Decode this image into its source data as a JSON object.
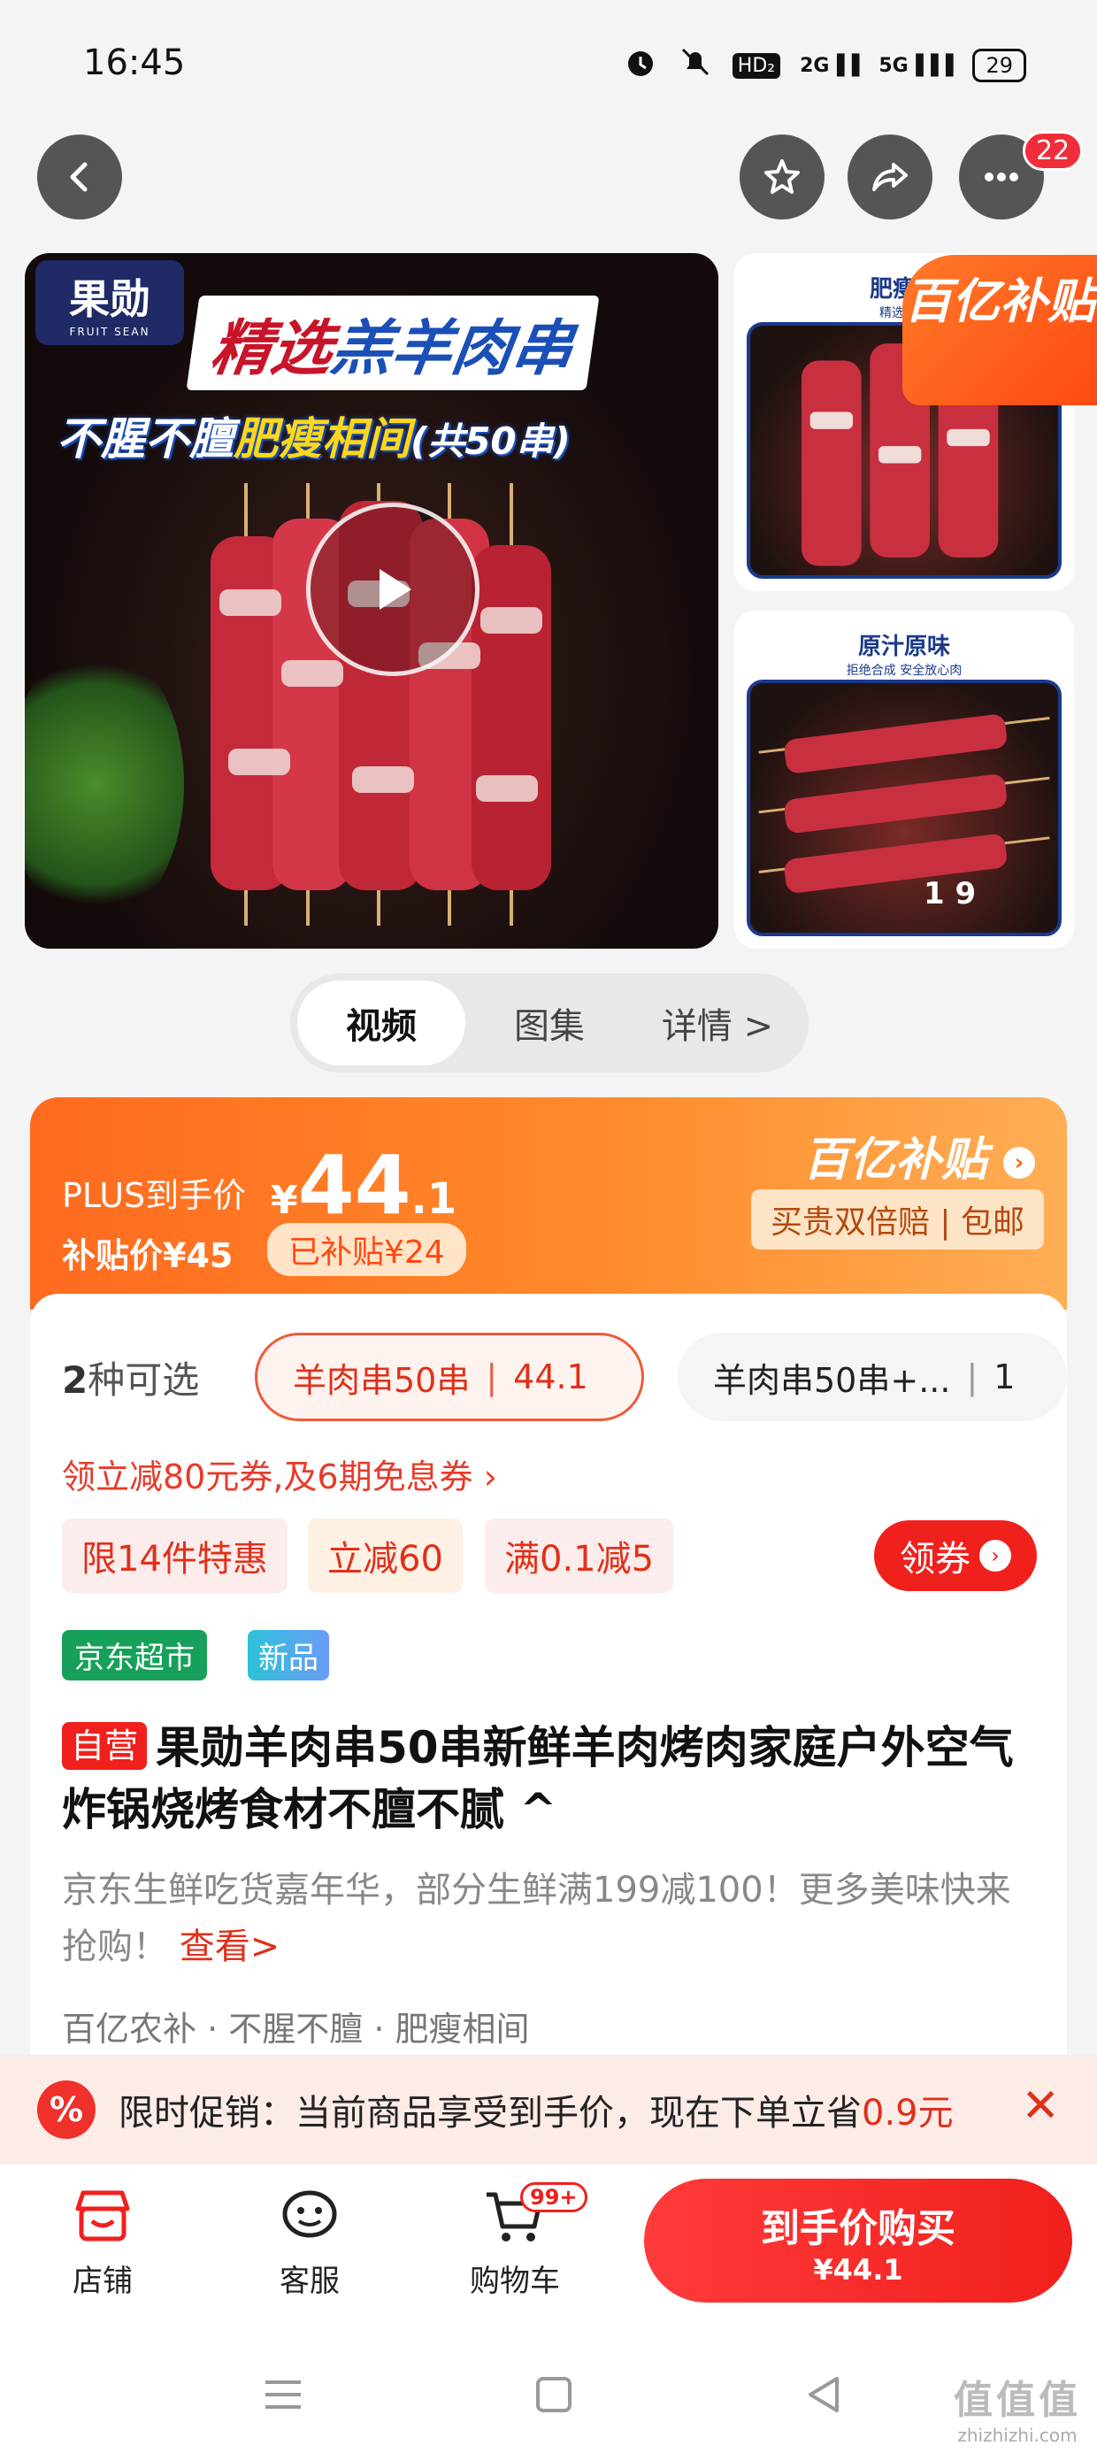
{
  "status_bar": {
    "time": "16:45",
    "network": "HD₂",
    "signal1": "2G",
    "signal2": "5G",
    "battery": "29"
  },
  "nav": {
    "notification_count": "22"
  },
  "media": {
    "logo_text": "果勋",
    "logo_sub": "FRUIT SEAN",
    "headline1_red": "精选",
    "headline1_blue": "羔羊肉串",
    "headline2_white": "不腥不膻",
    "headline2_yellow": "肥瘦相间",
    "headline2_small": "(共50串)",
    "thumb1_title": "肥瘦相",
    "thumb1_sub": "精选原料",
    "thumb2_title": "原汁原味",
    "thumb2_sub": "拒绝合成 安全放心肉",
    "subsidy_badge": "百亿补贴",
    "counter": "1  9"
  },
  "tabs": [
    "视频",
    "图集",
    "详情 >"
  ],
  "price": {
    "plus_label": "PLUS到手价",
    "yen": "¥",
    "integer": "44",
    "decimal": ".1",
    "subsidy_price": "补贴价¥45",
    "subsidy_tag": "已补贴¥24",
    "program": "百亿补贴",
    "guarantee": "买贵双倍赔 | 包邮"
  },
  "options": {
    "label_count": "2",
    "label_text": "种可选",
    "opt1_name": "羊肉串50串",
    "opt1_price": "44.1",
    "opt2_name": "羊肉串50串+...",
    "opt2_price": "1"
  },
  "coupon_line": "领立减80元券,及6期免息券 ›",
  "promos": [
    "限14件特惠",
    "立减60",
    "满0.1减5"
  ],
  "get_coupon": "领券",
  "tags": {
    "market": "京东超市",
    "new": "新品"
  },
  "title": {
    "self_tag": "自营",
    "text": "果勋羊肉串50串新鲜羊肉烤肉家庭户外空气炸锅烧烤食材不膻不腻 ^"
  },
  "description": {
    "text": "京东生鲜吃货嘉年华，部分生鲜满199减100！更多美味快来抢购！",
    "link": "查看>"
  },
  "features": "百亿农补 · 不腥不膻 · 肥瘦相间",
  "banner": {
    "icon": "%",
    "text": "限时促销：当前商品享受到手价，现在下单立省",
    "save": "0.9元",
    "close": "✕"
  },
  "bottom": {
    "shop": "店铺",
    "service": "客服",
    "cart": "购物车",
    "cart_badge": "99+",
    "buy_label": "到手价购买",
    "buy_price": "¥44.1"
  },
  "watermark": {
    "big": "值值值",
    "small": "zhizhizhi.com"
  },
  "colors": {
    "accent": "#f0201c",
    "orange": "#ff6a1f"
  }
}
